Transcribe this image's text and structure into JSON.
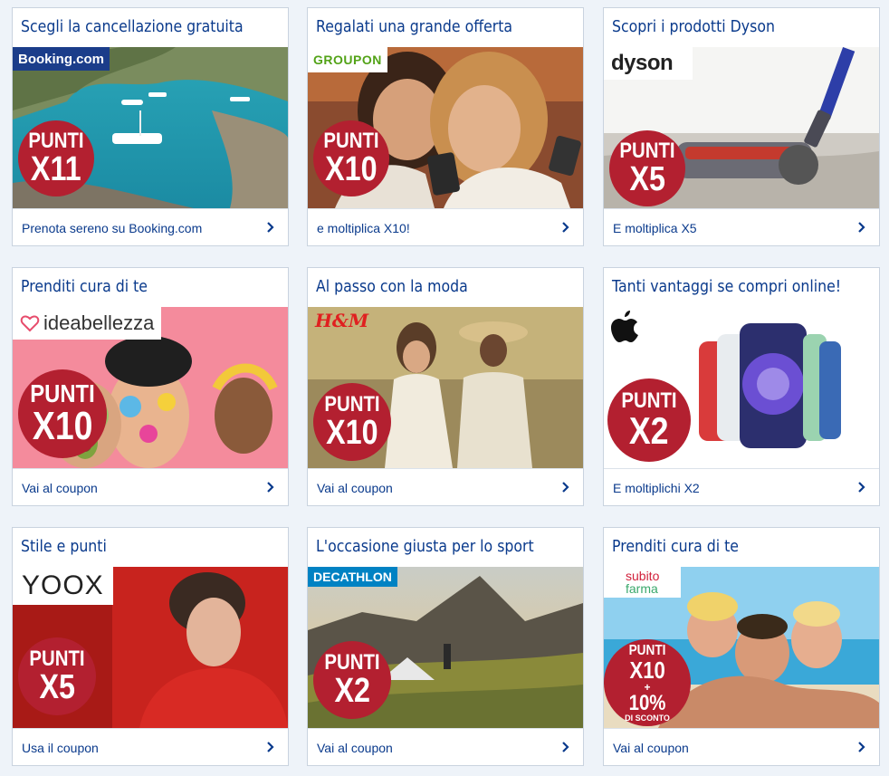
{
  "cards": [
    {
      "title": "Scegli la cancellazione gratuita",
      "brand": "Booking.com",
      "badge_top": "PUNTI",
      "badge_mult": "X11",
      "link": "Prenota sereno su Booking.com"
    },
    {
      "title": "Regalati una grande offerta",
      "brand": "GROUPON",
      "badge_top": "PUNTI",
      "badge_mult": "X10",
      "link": "e moltiplica X10!"
    },
    {
      "title": "Scopri i prodotti Dyson",
      "brand": "dyson",
      "badge_top": "PUNTI",
      "badge_mult": "X5",
      "link": "E moltiplica X5"
    },
    {
      "title": "Prenditi cura di te",
      "brand": "ideabellezza",
      "badge_top": "PUNTI",
      "badge_mult": "X10",
      "link": "Vai al coupon"
    },
    {
      "title": "Al passo con la moda",
      "brand": "H&M",
      "badge_top": "PUNTI",
      "badge_mult": "X10",
      "link": "Vai al coupon"
    },
    {
      "title": "Tanti vantaggi se compri online!",
      "brand": "apple",
      "badge_top": "PUNTI",
      "badge_mult": "X2",
      "link": "E moltiplichi X2"
    },
    {
      "title": "Stile e punti",
      "brand": "YOOX",
      "badge_top": "PUNTI",
      "badge_mult": "X5",
      "link": "Usa il coupon"
    },
    {
      "title": "L'occasione giusta per lo sport",
      "brand": "DECATHLON",
      "badge_top": "PUNTI",
      "badge_mult": "X2",
      "link": "Vai al coupon"
    },
    {
      "title": "Prenditi cura di te",
      "brand_line1": "subito",
      "brand_line2": "farma",
      "badge_top": "PUNTI",
      "badge_mult": "X10",
      "badge_plus": "+",
      "badge_pct": "10%",
      "badge_sconto": "DI SCONTO",
      "link": "Vai al coupon"
    }
  ],
  "colors": {
    "title": "#0a3a8c",
    "badge": "#b32030",
    "background": "#eef3f9"
  }
}
